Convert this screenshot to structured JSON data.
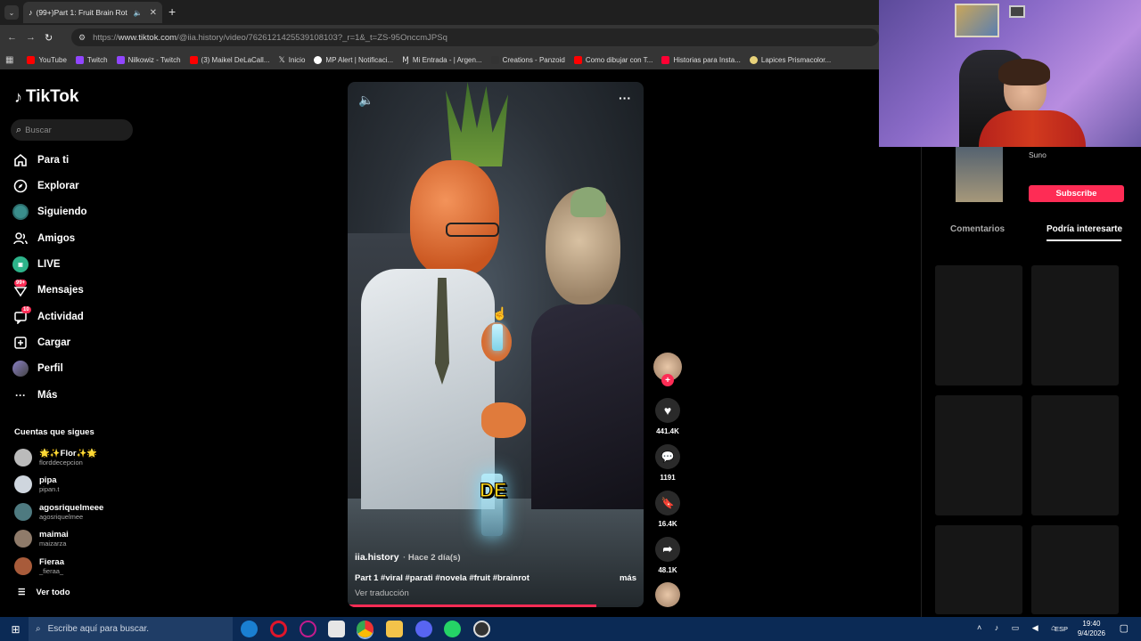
{
  "browser": {
    "tab_title": "(99+)Part 1: Fruit Brain Rot",
    "url_prefix": "https://",
    "url_host": "www.tiktok.com",
    "url_path": "/@iia.history/video/7626121425539108103?_r=1&_t=ZS-95OnccmJPSq",
    "bookmarks": [
      "YouTube",
      "Twitch",
      "Nilkowiz - Twitch",
      "(3) Maikel DeLaCall...",
      "Inicio",
      "MP Alert | Notificaci...",
      "Mi Entrada - | Argen...",
      "Creations - Panzoid",
      "Como dibujar con T...",
      "Historias para Insta...",
      "Lapices Prismacolor..."
    ],
    "bookmark_colors": [
      "#ff0000",
      "#9146ff",
      "#9146ff",
      "#ff0000",
      "#ffffff",
      "#444444",
      "#ffffff",
      "#333333",
      "#ff0000",
      "#ff0033",
      "#e8d27a"
    ]
  },
  "sidebar": {
    "logo": "TikTok",
    "search_placeholder": "Buscar",
    "nav": [
      {
        "label": "Para ti",
        "icon": "home-icon"
      },
      {
        "label": "Explorar",
        "icon": "compass-icon"
      },
      {
        "label": "Siguiendo",
        "icon": "following-avatar-icon"
      },
      {
        "label": "Amigos",
        "icon": "friends-icon"
      },
      {
        "label": "LIVE",
        "icon": "live-icon"
      },
      {
        "label": "Mensajes",
        "icon": "messages-icon",
        "badge": "99+"
      },
      {
        "label": "Actividad",
        "icon": "activity-icon",
        "badge": "10"
      },
      {
        "label": "Cargar",
        "icon": "upload-icon"
      },
      {
        "label": "Perfil",
        "icon": "profile-icon"
      },
      {
        "label": "Más",
        "icon": "more-icon"
      }
    ],
    "following_title": "Cuentas que sigues",
    "accounts": [
      {
        "name": "🌟✨Flor✨🌟",
        "handle": "florddecepcion"
      },
      {
        "name": "pipa",
        "handle": "pipan.t"
      },
      {
        "name": "agosriquelmeee",
        "handle": "agosriquelmee"
      },
      {
        "name": "maimai",
        "handle": "maizarza"
      },
      {
        "name": "Fieraa",
        "handle": "_fieraa_"
      }
    ],
    "see_all": "Ver todo"
  },
  "video": {
    "username": "iia.history",
    "time": "Hace 2 día(s)",
    "description": "Part 1 #viral #parati #novela #fruit #brainrot",
    "more": "más",
    "translate": "Ver traducción",
    "subtitle_word": "DE",
    "progress": 0.84
  },
  "actions": {
    "likes": "441.4K",
    "comments": "1191",
    "saves": "16.4K",
    "shares": "48.1K"
  },
  "right_panel": {
    "suggested_name": "Suno",
    "subscribe": "Subscribe",
    "tabs": [
      "Comentarios",
      "Podría interesarte"
    ]
  },
  "taskbar": {
    "search_placeholder": "Escribe aquí para buscar.",
    "lang": "ESP",
    "time": "19:40",
    "date": "9/4/2026"
  }
}
